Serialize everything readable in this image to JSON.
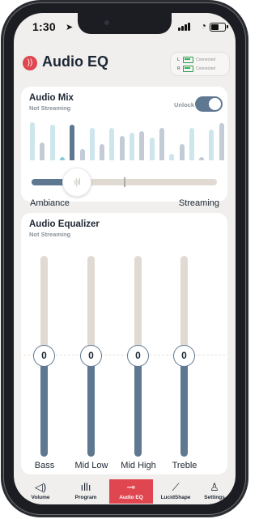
{
  "status_bar": {
    "time": "1:30"
  },
  "header": {
    "title": "Audio EQ",
    "connections": [
      {
        "side": "L",
        "status": "Connected"
      },
      {
        "side": "R",
        "status": "Connected"
      }
    ]
  },
  "audio_mix": {
    "title": "Audio Mix",
    "subtitle": "Not Streaming",
    "unlock_label": "Unlock",
    "unlocked": true,
    "left_label": "Ambiance",
    "right_label": "Streaming",
    "slider_value": 0.24
  },
  "equalizer": {
    "title": "Audio Equalizer",
    "subtitle": "Not Streaming",
    "bands": [
      {
        "label": "Bass",
        "value": "0"
      },
      {
        "label": "Mid Low",
        "value": "0"
      },
      {
        "label": "Mid High",
        "value": "0"
      },
      {
        "label": "Treble",
        "value": "0"
      }
    ]
  },
  "tabs": [
    {
      "label": "Volume",
      "icon": "speaker-icon"
    },
    {
      "label": "Program",
      "icon": "waveform-icon"
    },
    {
      "label": "Audio EQ",
      "icon": "sliders-icon",
      "active": true
    },
    {
      "label": "LucidShape",
      "icon": "chart-line-icon"
    },
    {
      "label": "Settings",
      "icon": "person-icon"
    }
  ],
  "colors": {
    "accent": "#e0464f",
    "slider": "#5e7891",
    "track": "#e0dad2",
    "text": "#1c2733"
  }
}
